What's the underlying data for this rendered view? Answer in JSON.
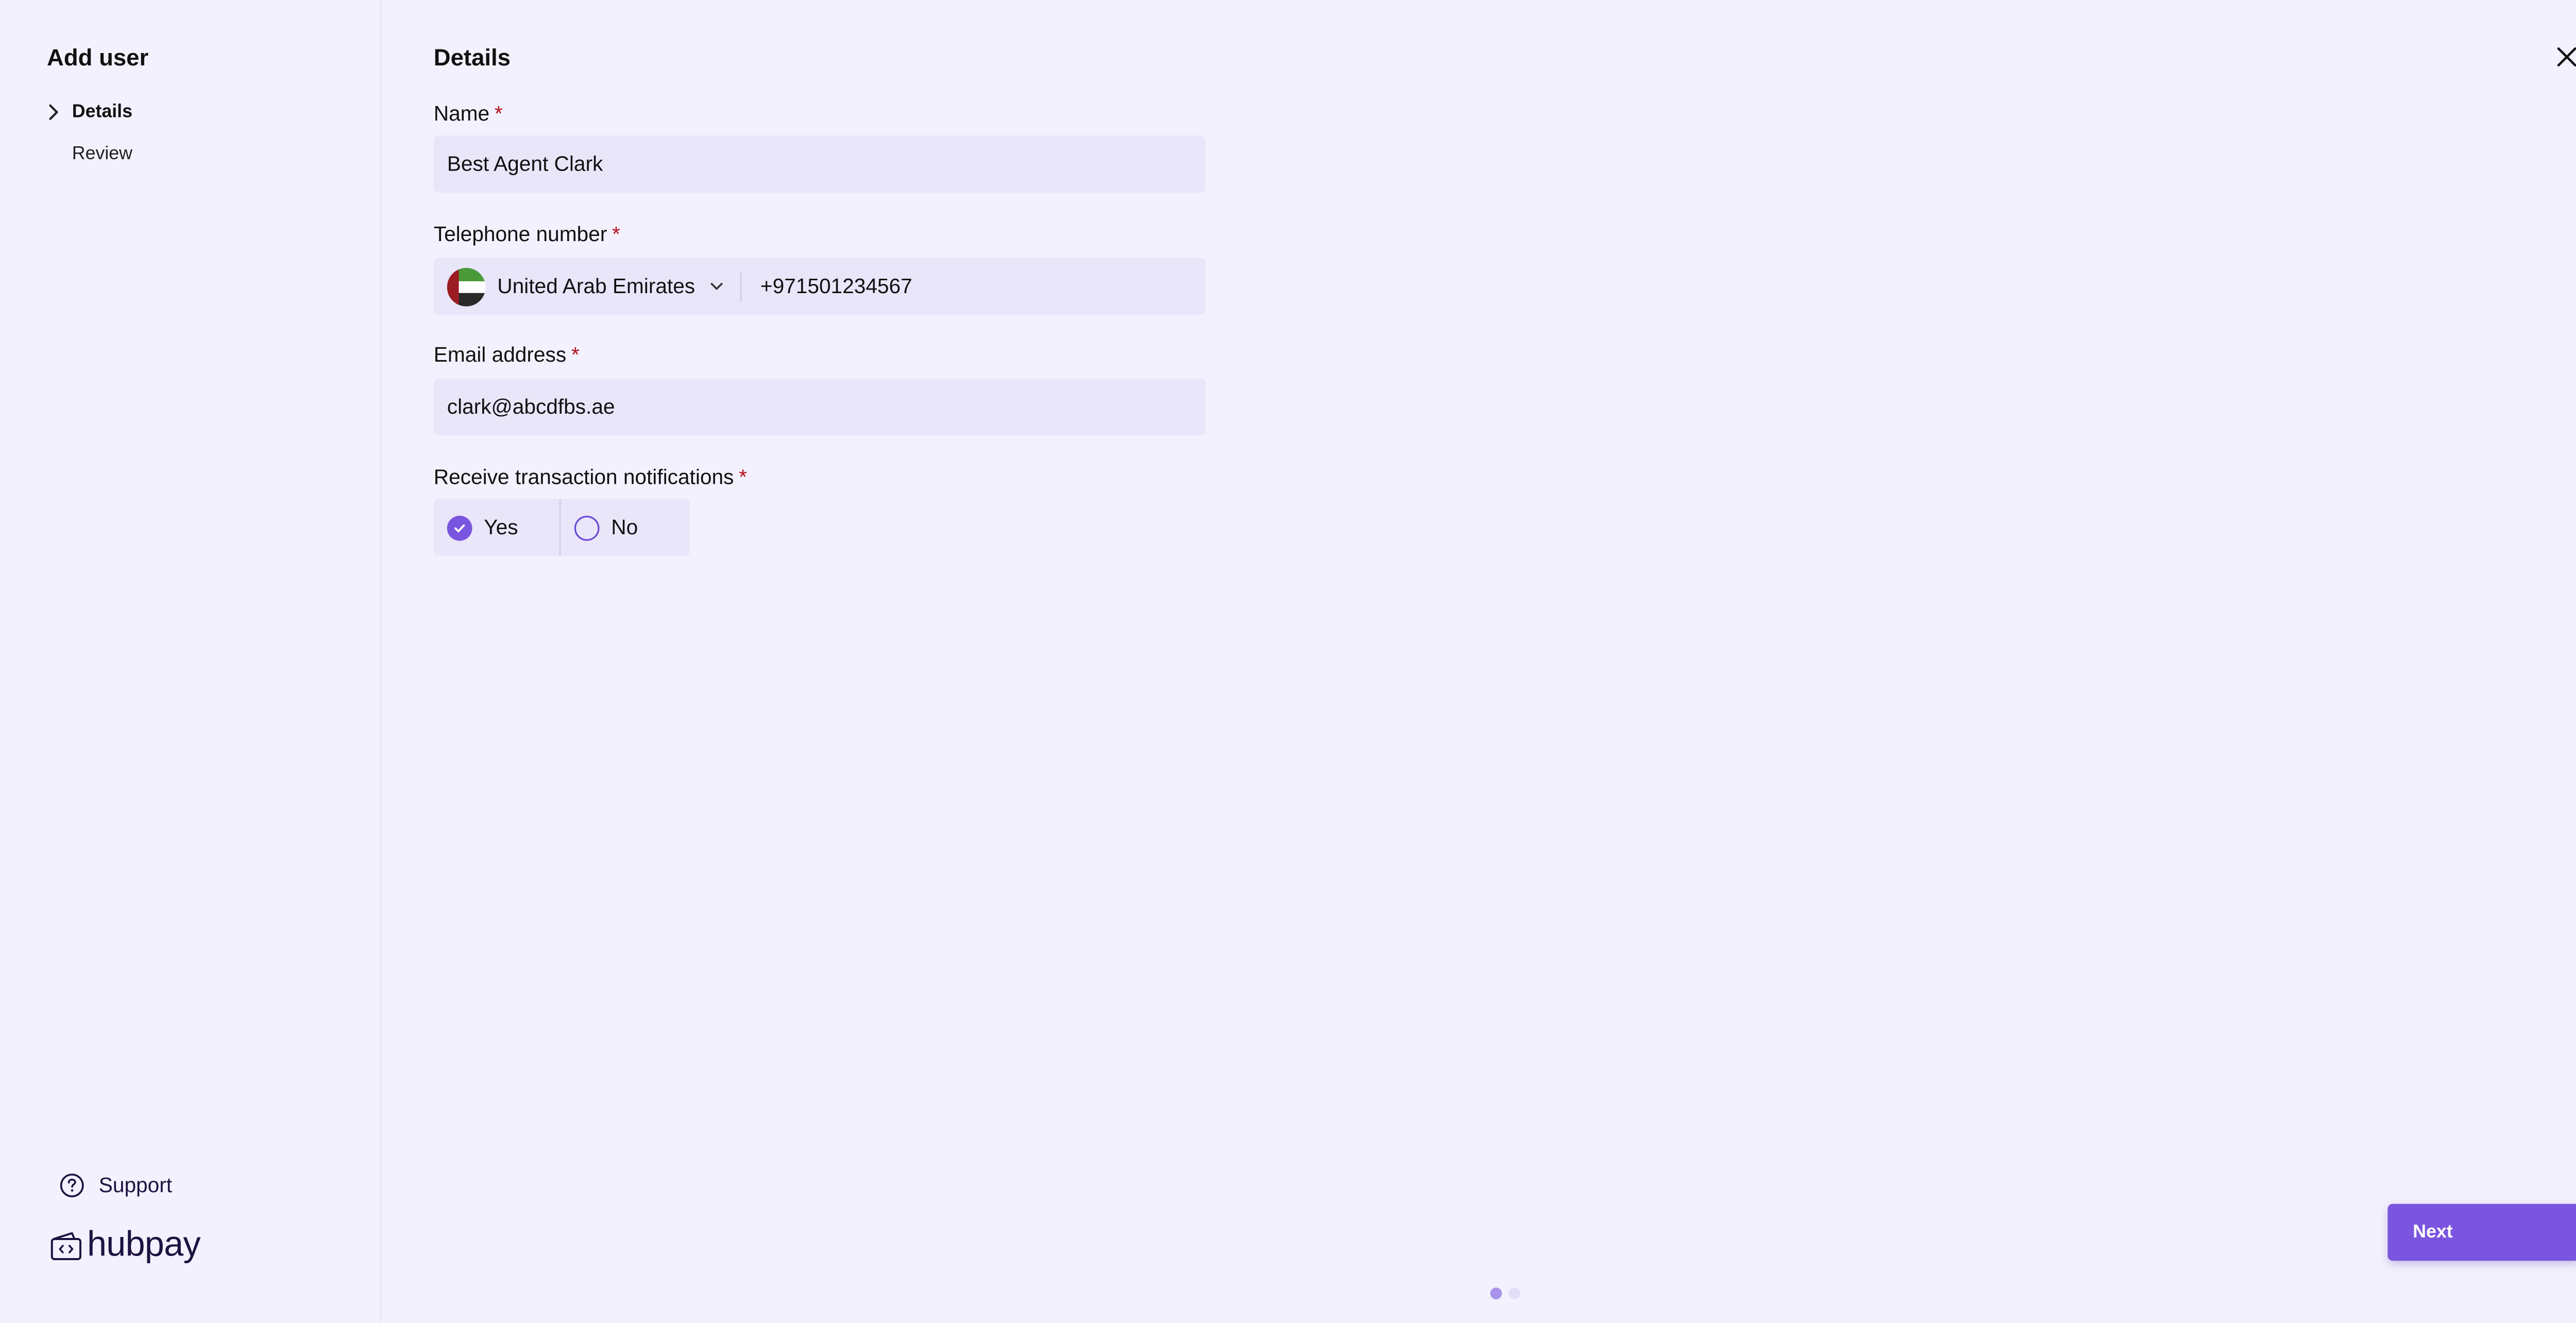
{
  "sidebar": {
    "title": "Add user",
    "steps": [
      {
        "label": "Details",
        "active": true
      },
      {
        "label": "Review",
        "active": false
      }
    ],
    "support_label": "Support",
    "logo_text": "hubpay"
  },
  "form": {
    "title": "Details",
    "name": {
      "label": "Name",
      "required_mark": "*",
      "value": "Best Agent Clark"
    },
    "phone": {
      "label": "Telephone number",
      "required_mark": "*",
      "country": "United Arab Emirates",
      "country_flag": "uae-flag-icon",
      "number": "+971501234567"
    },
    "email": {
      "label": "Email address",
      "required_mark": "*",
      "value": "clark@abcdfbs.ae"
    },
    "notifications": {
      "label": "Receive transaction notifications",
      "required_mark": "*",
      "options": [
        {
          "label": "Yes",
          "selected": true
        },
        {
          "label": "No",
          "selected": false
        }
      ]
    }
  },
  "actions": {
    "next_label": "Next"
  },
  "pager": {
    "current": 1,
    "total": 2
  },
  "colors": {
    "background": "#f3f1fd",
    "field_background": "#e9e6fa",
    "accent": "#7a55df",
    "required": "#b5121b",
    "brand_text": "#1d1240"
  }
}
